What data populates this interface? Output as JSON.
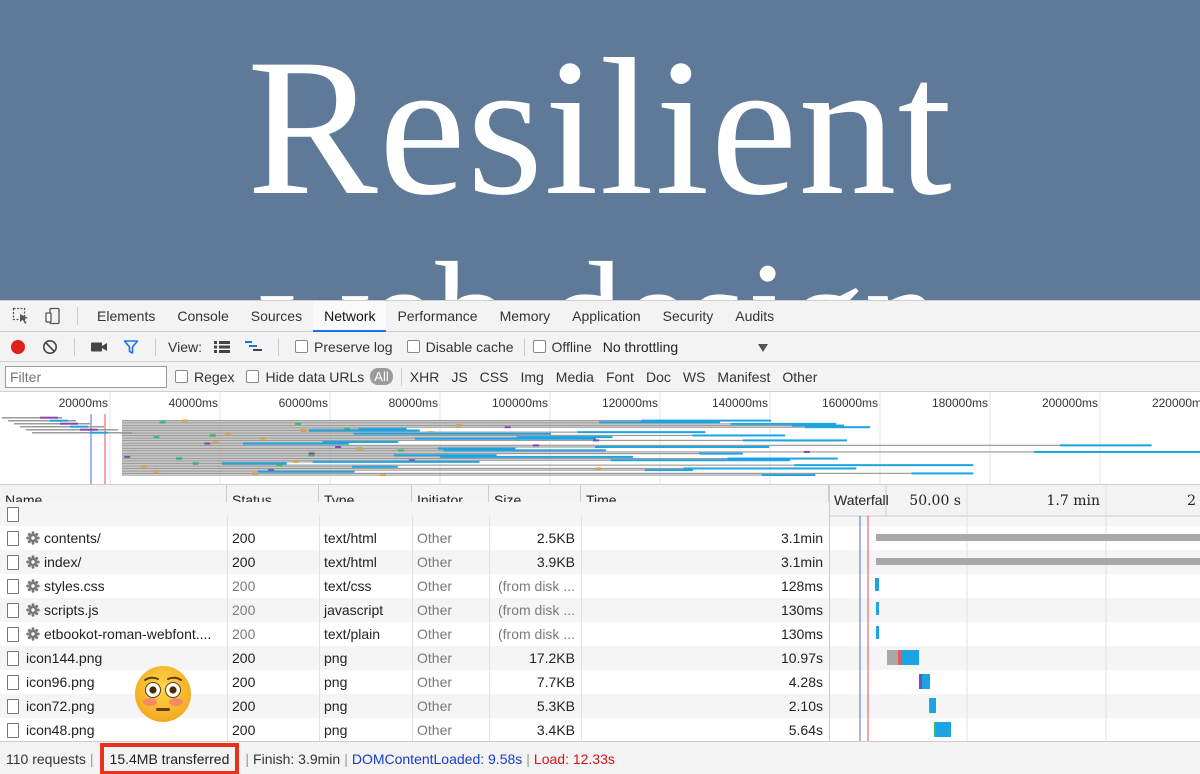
{
  "page": {
    "hero_title": "Resilient",
    "hero_sub": "web design"
  },
  "devtools": {
    "tabs": [
      "Elements",
      "Console",
      "Sources",
      "Network",
      "Performance",
      "Memory",
      "Application",
      "Security",
      "Audits"
    ],
    "active_tab": "Network",
    "toolbar": {
      "view_label": "View:",
      "preserve_log": "Preserve log",
      "disable_cache": "Disable cache",
      "offline": "Offline",
      "throttling": "No throttling"
    },
    "filterbar": {
      "filter_placeholder": "Filter",
      "regex": "Regex",
      "hide_data_urls": "Hide data URLs",
      "types": [
        "All",
        "XHR",
        "JS",
        "CSS",
        "Img",
        "Media",
        "Font",
        "Doc",
        "WS",
        "Manifest",
        "Other"
      ]
    },
    "overview_ticks": [
      "20000ms",
      "40000ms",
      "60000ms",
      "80000ms",
      "100000ms",
      "120000ms",
      "140000ms",
      "160000ms",
      "180000ms",
      "200000ms",
      "220000ms"
    ],
    "columns": [
      "Name",
      "Status",
      "Type",
      "Initiator",
      "Size",
      "Time"
    ],
    "waterfall": {
      "label": "Waterfall",
      "ticks": [
        "50.00 s",
        "1.7 min",
        "2"
      ]
    },
    "rows": [
      {
        "name": "contents/",
        "status": "200",
        "type": "text/html",
        "initiator": "Other",
        "size": "2.5KB",
        "time": "3.1min",
        "gear": true,
        "cached": false
      },
      {
        "name": "index/",
        "status": "200",
        "type": "text/html",
        "initiator": "Other",
        "size": "3.9KB",
        "time": "3.1min",
        "gear": true,
        "cached": false
      },
      {
        "name": "styles.css",
        "status": "200",
        "type": "text/css",
        "initiator": "Other",
        "size": "(from disk ...",
        "time": "128ms",
        "gear": true,
        "cached": true
      },
      {
        "name": "scripts.js",
        "status": "200",
        "type": "javascript",
        "initiator": "Other",
        "size": "(from disk ...",
        "time": "130ms",
        "gear": true,
        "cached": true
      },
      {
        "name": "etbookot-roman-webfont....",
        "status": "200",
        "type": "text/plain",
        "initiator": "Other",
        "size": "(from disk ...",
        "time": "130ms",
        "gear": true,
        "cached": true
      },
      {
        "name": "icon144.png",
        "status": "200",
        "type": "png",
        "initiator": "Other",
        "size": "17.2KB",
        "time": "10.97s",
        "gear": false,
        "cached": false
      },
      {
        "name": "icon96.png",
        "status": "200",
        "type": "png",
        "initiator": "Other",
        "size": "7.7KB",
        "time": "4.28s",
        "gear": false,
        "cached": false
      },
      {
        "name": "icon72.png",
        "status": "200",
        "type": "png",
        "initiator": "Other",
        "size": "5.3KB",
        "time": "2.10s",
        "gear": false,
        "cached": false
      },
      {
        "name": "icon48.png",
        "status": "200",
        "type": "png",
        "initiator": "Other",
        "size": "3.4KB",
        "time": "5.64s",
        "gear": false,
        "cached": false
      }
    ],
    "statusbar": {
      "requests": "110 requests",
      "transferred": "15.4MB transferred",
      "finish": "Finish: 3.9min",
      "dcl": "DOMContentLoaded: 9.58s",
      "load": "Load: 12.33s"
    }
  },
  "colors": {
    "page_bg": "#5f7a98",
    "highlight_box": "#e8321c",
    "dcl_blue": "#1a3ccc",
    "load_red": "#d0141b",
    "bar_blue": "#1ba3e4",
    "bar_gray": "#a8a8a8"
  },
  "emoji": "flushed-face-icon"
}
